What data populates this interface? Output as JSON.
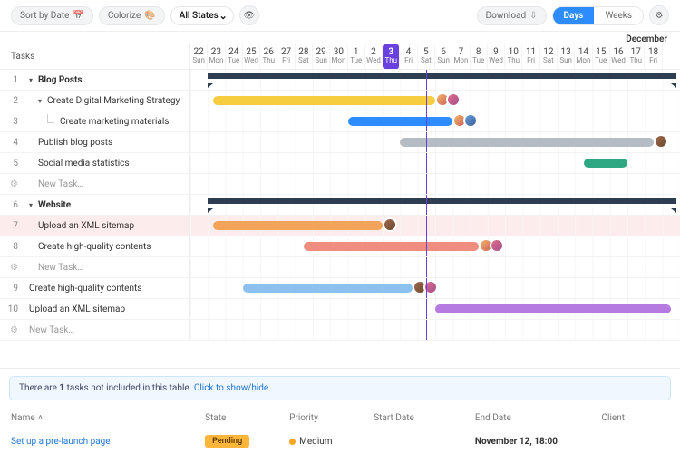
{
  "toolbar": {
    "sort": "Sort by Date",
    "colorize": "Colorize",
    "states": "All States",
    "download": "Download",
    "days": "Days",
    "weeks": "Weeks"
  },
  "month_label": "December",
  "dates": [
    {
      "n": "22",
      "d": "Sun"
    },
    {
      "n": "23",
      "d": "Mon"
    },
    {
      "n": "24",
      "d": "Tue"
    },
    {
      "n": "25",
      "d": "Wed"
    },
    {
      "n": "26",
      "d": "Thu"
    },
    {
      "n": "27",
      "d": "Fri"
    },
    {
      "n": "28",
      "d": "Sat"
    },
    {
      "n": "29",
      "d": "Sun"
    },
    {
      "n": "30",
      "d": "Mon"
    },
    {
      "n": "1",
      "d": "Tue"
    },
    {
      "n": "2",
      "d": "Wed"
    },
    {
      "n": "3",
      "d": "Thu"
    },
    {
      "n": "4",
      "d": "Fri"
    },
    {
      "n": "5",
      "d": "Sat"
    },
    {
      "n": "6",
      "d": "Sun"
    },
    {
      "n": "7",
      "d": "Mon"
    },
    {
      "n": "8",
      "d": "Tue"
    },
    {
      "n": "9",
      "d": "Wed"
    },
    {
      "n": "10",
      "d": "Thu"
    },
    {
      "n": "11",
      "d": "Fri"
    },
    {
      "n": "12",
      "d": "Sat"
    },
    {
      "n": "13",
      "d": "Sun"
    },
    {
      "n": "14",
      "d": "Mon"
    },
    {
      "n": "15",
      "d": "Tue"
    },
    {
      "n": "16",
      "d": "Wed"
    },
    {
      "n": "17",
      "d": "Thu"
    },
    {
      "n": "18",
      "d": "Fri"
    }
  ],
  "today_index": 11,
  "tasks_header": "Tasks",
  "rows": [
    {
      "num": "1",
      "label": "Blog Posts",
      "bold": true,
      "chev": true
    },
    {
      "num": "2",
      "label": "Create Digital Marketing Strategy",
      "chev": true,
      "indent": 1
    },
    {
      "num": "3",
      "label": "Create marketing materials",
      "indent": 2,
      "hier": true
    },
    {
      "num": "4",
      "label": "Publish blog posts",
      "indent": 1
    },
    {
      "num": "5",
      "label": "Social media statistics",
      "indent": 1
    },
    {
      "gear": true,
      "label": "New Task…",
      "new": true,
      "indent": 1
    },
    {
      "num": "6",
      "label": "Website",
      "bold": true,
      "chev": true
    },
    {
      "num": "7",
      "label": "Upload an XML sitemap",
      "indent": 1,
      "hl": true
    },
    {
      "num": "8",
      "label": "Create high-quality contents",
      "indent": 1
    },
    {
      "gear": true,
      "label": "New Task…",
      "new": true,
      "indent": 1
    },
    {
      "num": "9",
      "label": "Create high-quality contents"
    },
    {
      "num": "10",
      "label": "Upload an XML sitemap"
    },
    {
      "gear": true,
      "label": "New Task…",
      "new": true
    }
  ],
  "notice": {
    "pre": "There are ",
    "bold": "1",
    "mid": " tasks not included in this table. ",
    "link": "Click to show/hide"
  },
  "table": {
    "headers": [
      "Name",
      "State",
      "Priority",
      "Start Date",
      "End Date",
      "Client"
    ],
    "row": {
      "name": "Set up a pre-launch page",
      "state": "Pending",
      "priority": "Medium",
      "start": "",
      "end": "November 12, 18:00",
      "client": ""
    }
  }
}
